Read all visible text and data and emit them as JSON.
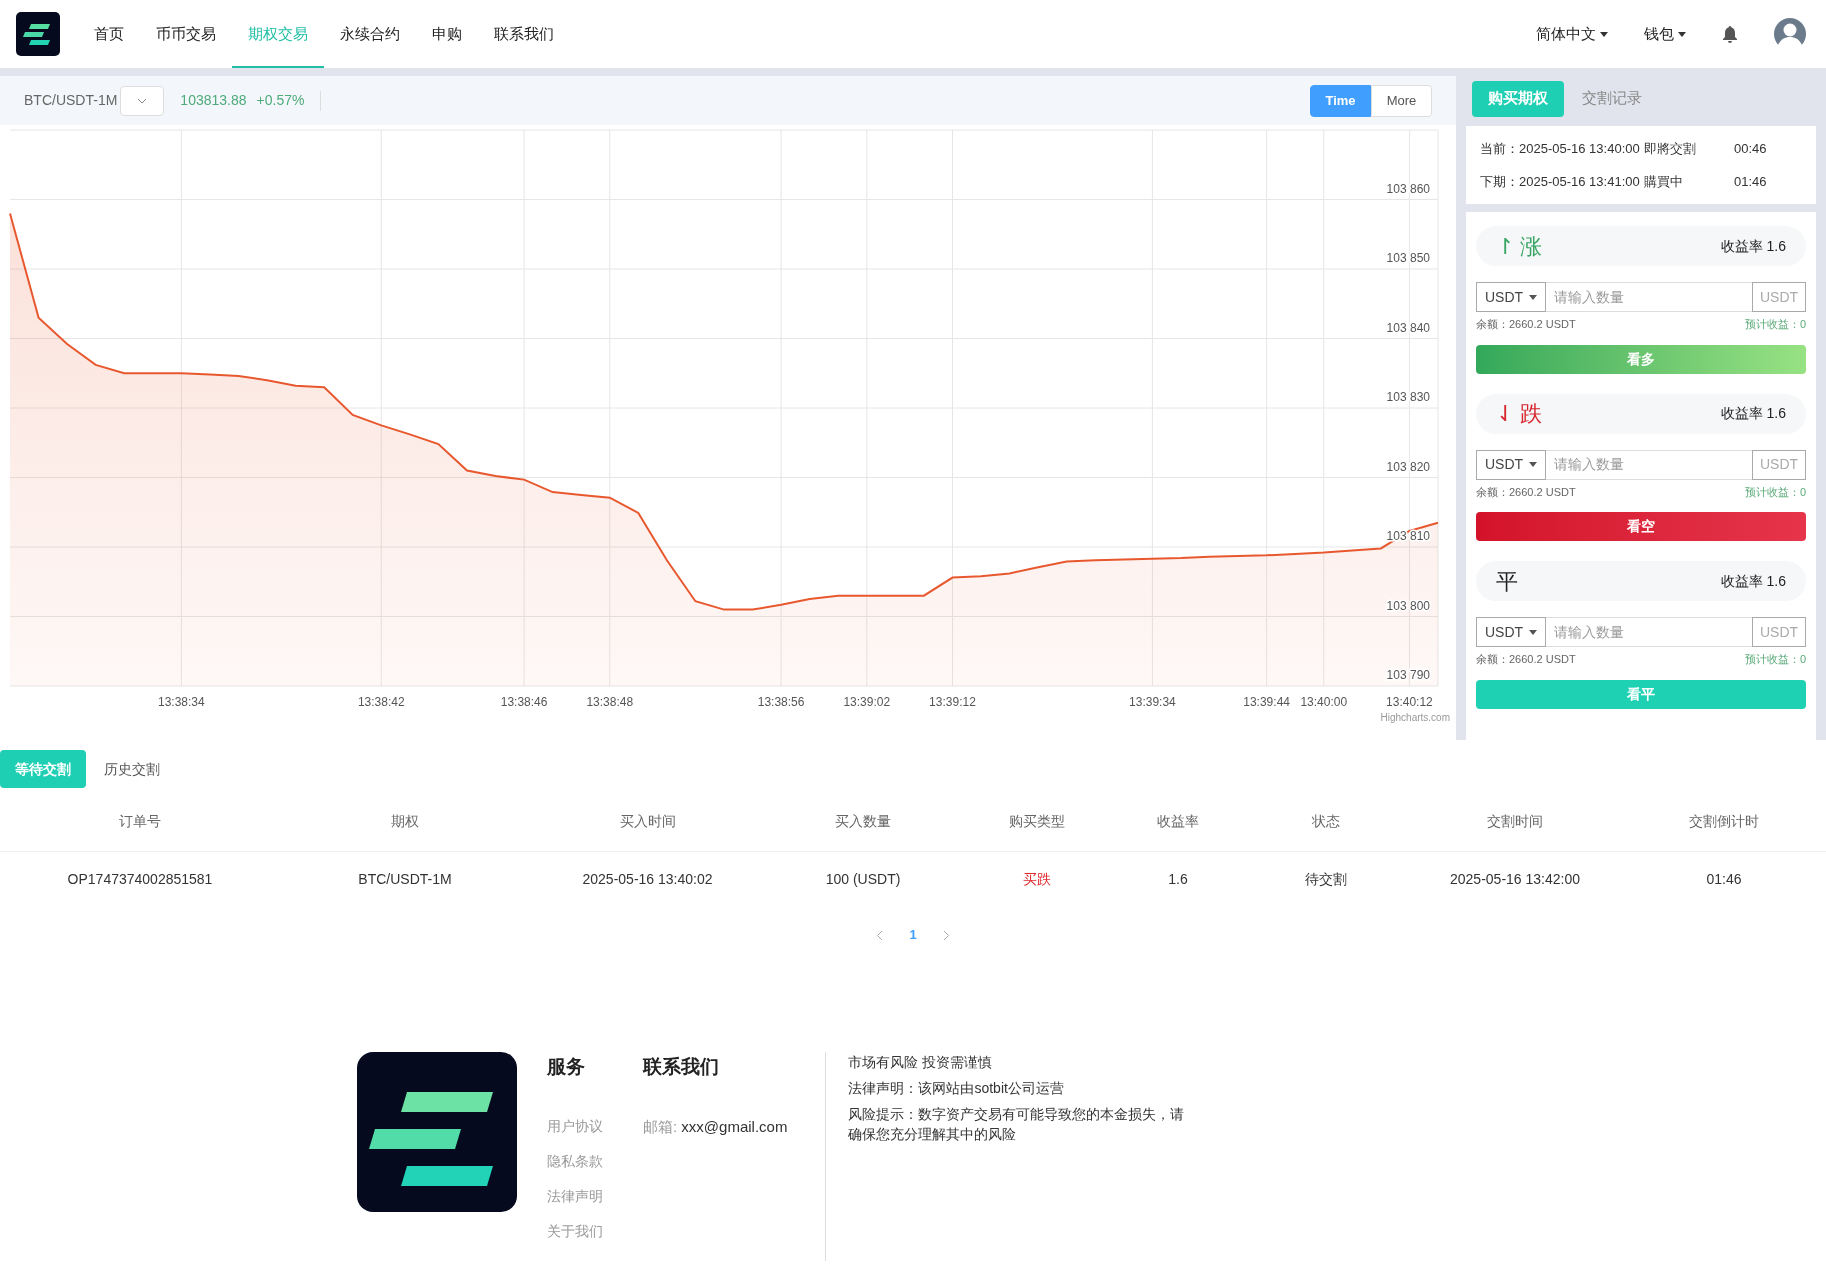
{
  "header": {
    "nav": [
      {
        "label": "首页",
        "selected": false
      },
      {
        "label": "币币交易",
        "selected": false
      },
      {
        "label": "期权交易",
        "selected": true
      },
      {
        "label": "永续合约",
        "selected": false
      },
      {
        "label": "申购",
        "selected": false
      },
      {
        "label": "联系我们",
        "selected": false
      }
    ],
    "language": "简体中文",
    "wallet": "钱包"
  },
  "chart_panel": {
    "symbol": "BTC/USDT-1M",
    "price": "103813.88",
    "change": "+0.57%",
    "range_buttons": [
      {
        "label": "Time",
        "selected": true
      },
      {
        "label": "More",
        "selected": false
      }
    ],
    "credit": "Highcharts.com",
    "chart_data": {
      "type": "area",
      "categories": [
        null,
        null,
        null,
        null,
        null,
        null,
        "13:38:34",
        null,
        null,
        null,
        null,
        null,
        null,
        "13:38:42",
        null,
        null,
        null,
        null,
        "13:38:46",
        null,
        null,
        "13:38:48",
        null,
        null,
        null,
        null,
        null,
        "13:38:56",
        null,
        null,
        "13:39:02",
        null,
        null,
        "13:39:12",
        null,
        null,
        null,
        null,
        null,
        null,
        "13:39:34",
        null,
        null,
        null,
        "13:39:44",
        null,
        "13:40:00",
        null,
        null,
        "13:40:12",
        null
      ],
      "series": [
        {
          "color": "#e8582f",
          "values": [
            103858,
            103843,
            103839.2,
            103836.2,
            103835,
            103835,
            103835,
            103834.8,
            103834.6,
            103834,
            103833.2,
            103833,
            103829,
            103827.5,
            103826.2,
            103824.8,
            103821,
            103820.2,
            103819.7,
            103817.9,
            103817.5,
            103817.1,
            103814.9,
            103808.1,
            103802.2,
            103801,
            103801,
            103801.7,
            103802.5,
            103803,
            103803,
            103803,
            103803,
            103805.6,
            103805.8,
            103806.2,
            103807.1,
            103807.9,
            103808.1,
            103808.2,
            103808.3,
            103808.4,
            103808.6,
            103808.7,
            103808.8,
            103809,
            103809.2,
            103809.5,
            103809.8,
            103812.3,
            103813.5
          ]
        }
      ],
      "ylim": [
        103790,
        103870
      ],
      "grid": true,
      "yticks": [
        {
          "value": 103790,
          "label": "103 790"
        },
        {
          "value": 103800,
          "label": "103 800"
        },
        {
          "value": 103810,
          "label": "103 810"
        },
        {
          "value": 103820,
          "label": "103 820"
        },
        {
          "value": 103830,
          "label": "103 830"
        },
        {
          "value": 103840,
          "label": "103 840"
        },
        {
          "value": 103850,
          "label": "103 850"
        },
        {
          "value": 103860,
          "label": "103 860"
        }
      ]
    }
  },
  "order_panel": {
    "tabs": [
      {
        "label": "购买期权",
        "selected": true
      },
      {
        "label": "交割记录",
        "selected": false
      }
    ],
    "periods": [
      {
        "label": "当前：2025-05-16 13:40:00",
        "status": "即將交割",
        "countdown": "00:46"
      },
      {
        "label": "下期：2025-05-16 13:41:00",
        "status": "購買中",
        "countdown": "01:46"
      }
    ],
    "options": [
      {
        "kind": "up",
        "arrow": "↾",
        "title": "涨",
        "yield": "收益率 1.6",
        "currency": "USDT",
        "placeholder": "请输入数量",
        "unit": "USDT",
        "balance": "余额：2660.2 USDT",
        "estimate": "预计收益：0",
        "action": "看多"
      },
      {
        "kind": "down",
        "arrow": "⇃",
        "title": "跌",
        "yield": "收益率 1.6",
        "currency": "USDT",
        "placeholder": "请输入数量",
        "unit": "USDT",
        "balance": "余额：2660.2 USDT",
        "estimate": "预计收益：0",
        "action": "看空"
      },
      {
        "kind": "flat",
        "title": "平",
        "yield": "收益率 1.6",
        "currency": "USDT",
        "placeholder": "请输入数量",
        "unit": "USDT",
        "balance": "余额：2660.2 USDT",
        "estimate": "预计收益：0",
        "action": "看平"
      }
    ]
  },
  "orders": {
    "tabs": [
      {
        "label": "等待交割",
        "selected": true
      },
      {
        "label": "历史交割",
        "selected": false
      }
    ],
    "columns": [
      "订单号",
      "期权",
      "买入时间",
      "买入数量",
      "购买类型",
      "收益率",
      "状态",
      "交割时间",
      "交割倒计时"
    ],
    "rows": [
      {
        "cells": [
          "OP1747374002851581",
          "BTC/USDT-1M",
          "2025-05-16 13:40:02",
          "100 (USDT)",
          "买跌",
          "1.6",
          "待交割",
          "2025-05-16 13:42:00",
          "01:46"
        ]
      }
    ],
    "pages": [
      {
        "label": "1",
        "selected": true
      }
    ]
  },
  "footer": {
    "services_title": "服务",
    "services": [
      "用户协议",
      "隐私条款",
      "法律声明",
      "关于我们"
    ],
    "contact_title": "联系我们",
    "email_label": "邮箱:",
    "email": "xxx@gmail.com",
    "notices": [
      "市场有风险 投资需谨慎",
      "法律声明：该网站由sotbit公司运营",
      "风险提示：数字资产交易有可能导致您的本金损失，请确保您充分理解其中的风险"
    ]
  }
}
